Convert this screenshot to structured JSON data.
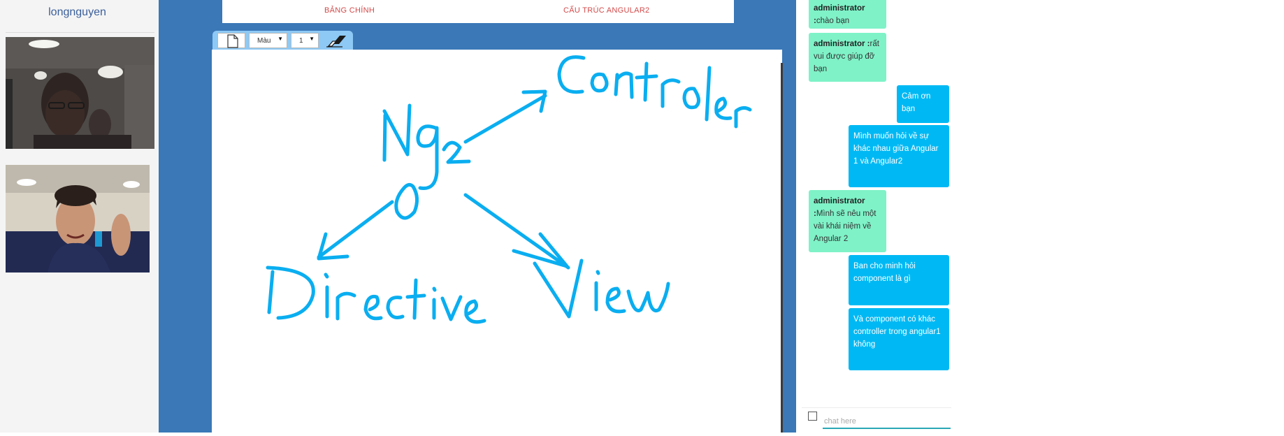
{
  "user_panel": {
    "username": "longnguyen"
  },
  "board": {
    "tabs": [
      "BẢNG CHÍNH",
      "CẤU TRÚC ANGULAR2"
    ],
    "toolbar": {
      "color_label": "Màu",
      "size_value": "1",
      "caret": "▼"
    },
    "drawing_words": [
      "Ng2",
      "Controler",
      "Directive",
      "View"
    ],
    "ink_color": "#0aaef0"
  },
  "chat": {
    "messages": [
      {
        "author": "administrator :",
        "text": "chào bạn"
      },
      {
        "author": "administrator :",
        "text": "rất vui được giúp đỡ bạn"
      },
      {
        "author": "",
        "text": "Cảm ơn bạn"
      },
      {
        "author": "",
        "text": "Mình muốn hỏi về sự khác nhau giữa Angular 1 và Angular2"
      },
      {
        "author": "administrator :",
        "text": "Mình sẽ nêu một vài khái niệm về Angular 2"
      },
      {
        "author": "",
        "text": "Ban cho minh hỏi component là gì"
      },
      {
        "author": "",
        "text": "Và component có khác controller trong angular1 không"
      }
    ],
    "input_placeholder": "chat here"
  },
  "colors": {
    "board_background": "#3a78b7",
    "admin_bubble": "#7ff2c8",
    "user_bubble": "#00b9f4",
    "tab_text": "#d24a4a"
  }
}
